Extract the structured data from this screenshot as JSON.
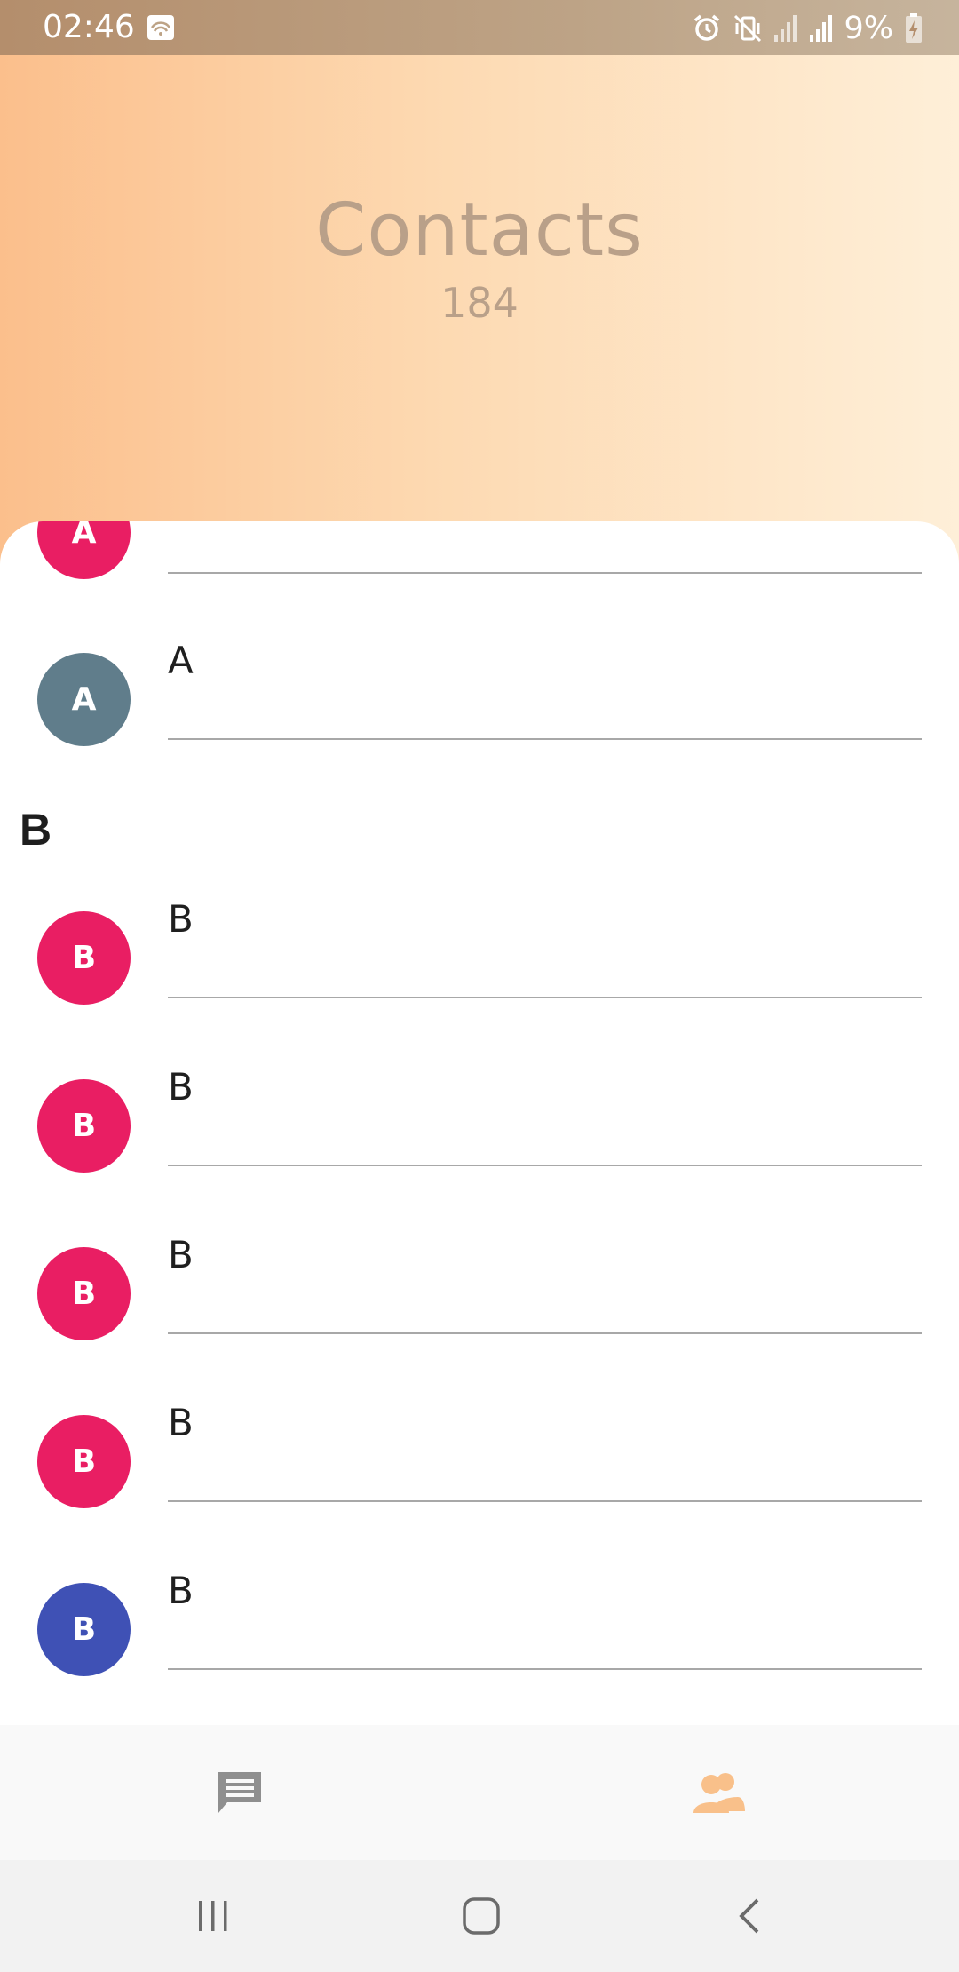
{
  "status_bar": {
    "time": "02:46",
    "battery": "9%",
    "icons": [
      "message-icon",
      "alarm-icon",
      "vibrate-icon",
      "signal-icon",
      "signal-icon",
      "battery-charging-icon"
    ]
  },
  "header": {
    "title": "Contacts",
    "count": "184"
  },
  "contacts": {
    "rows_a": [
      {
        "initial": "A",
        "name": "",
        "color": "#e91e63"
      },
      {
        "initial": "A",
        "name": "A",
        "color": "#607d8b"
      }
    ],
    "section_b": "B",
    "rows_b": [
      {
        "initial": "B",
        "name": "B",
        "color": "#e91e63"
      },
      {
        "initial": "B",
        "name": "B",
        "color": "#e91e63"
      },
      {
        "initial": "B",
        "name": "B",
        "color": "#e91e63"
      },
      {
        "initial": "B",
        "name": "B",
        "color": "#e91e63"
      },
      {
        "initial": "B",
        "name": "B",
        "color": "#3f51b5"
      }
    ]
  },
  "tabs": [
    {
      "icon": "chat-icon",
      "active": false
    },
    {
      "icon": "contacts-icon",
      "active": true
    }
  ],
  "colors": {
    "accent": "#f9c08a",
    "inactive_icon": "#8f8f8f",
    "header_text": "#b9a089"
  },
  "nav": {
    "icons": [
      "recent-apps-icon",
      "home-icon",
      "back-icon"
    ]
  }
}
